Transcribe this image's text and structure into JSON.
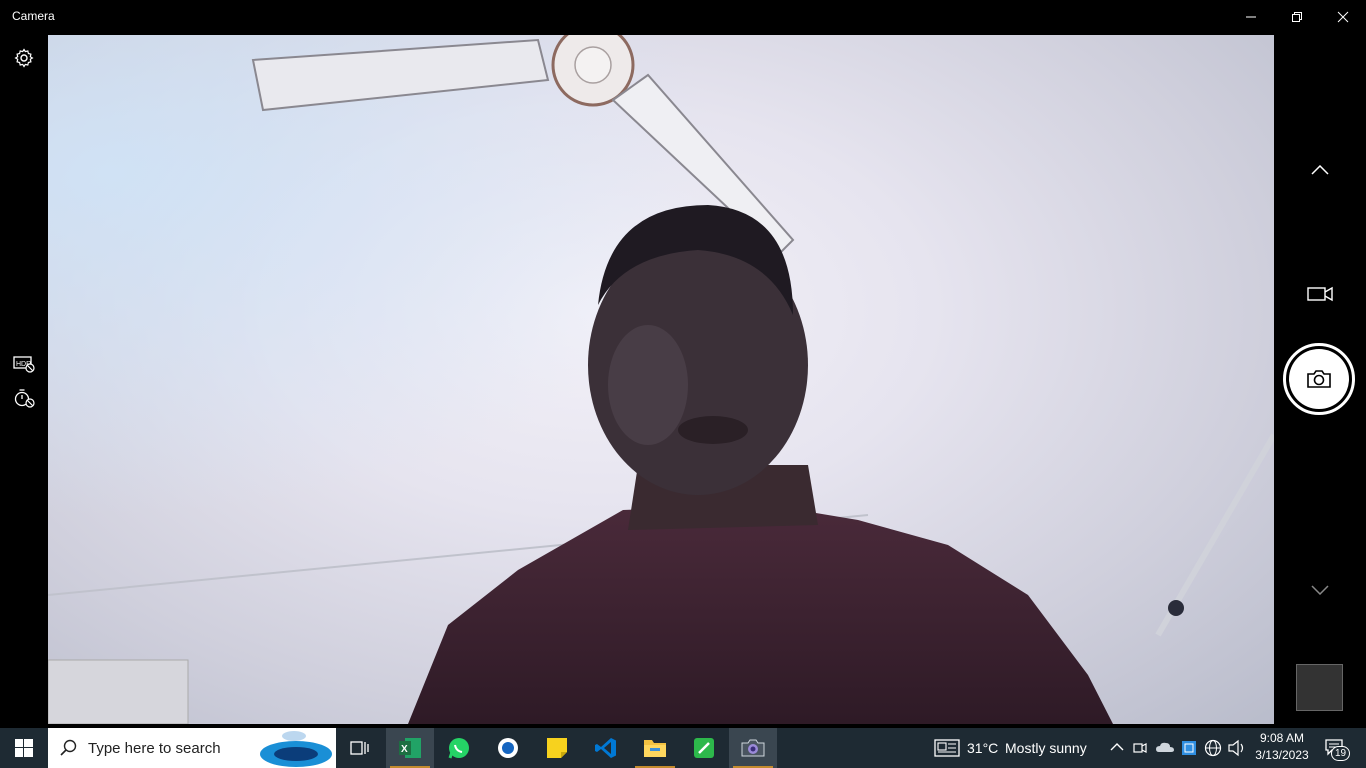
{
  "window": {
    "title": "Camera",
    "minimize_icon": "minimize-icon",
    "restore_icon": "restore-icon",
    "close_icon": "close-icon"
  },
  "left_rail": {
    "settings_icon": "gear-icon",
    "hdr_icon": "hdr-off-icon",
    "timer_icon": "timer-off-icon"
  },
  "right_rail": {
    "up_icon": "chevron-up-icon",
    "video_icon": "video-camera-icon",
    "photo_icon": "camera-icon",
    "down_icon": "chevron-down-icon",
    "thumbnail": "last-capture-thumbnail"
  },
  "taskbar": {
    "search_placeholder": "Type here to search",
    "apps": [
      "Task View",
      "Excel",
      "WhatsApp",
      "App",
      "Sticky Notes",
      "Visual Studio Code",
      "File Explorer",
      "Green App",
      "Camera"
    ],
    "weather": {
      "temp": "31°C",
      "condition": "Mostly sunny"
    },
    "time": "9:08 AM",
    "date": "3/13/2023",
    "notification_count": "19"
  },
  "colors": {
    "taskbar_bg": "#1e2a33",
    "accent_excel": "#1d6f42",
    "accent_whatsapp": "#25d366",
    "accent_vscode": "#0078d4",
    "underline": "#c38b2e"
  }
}
